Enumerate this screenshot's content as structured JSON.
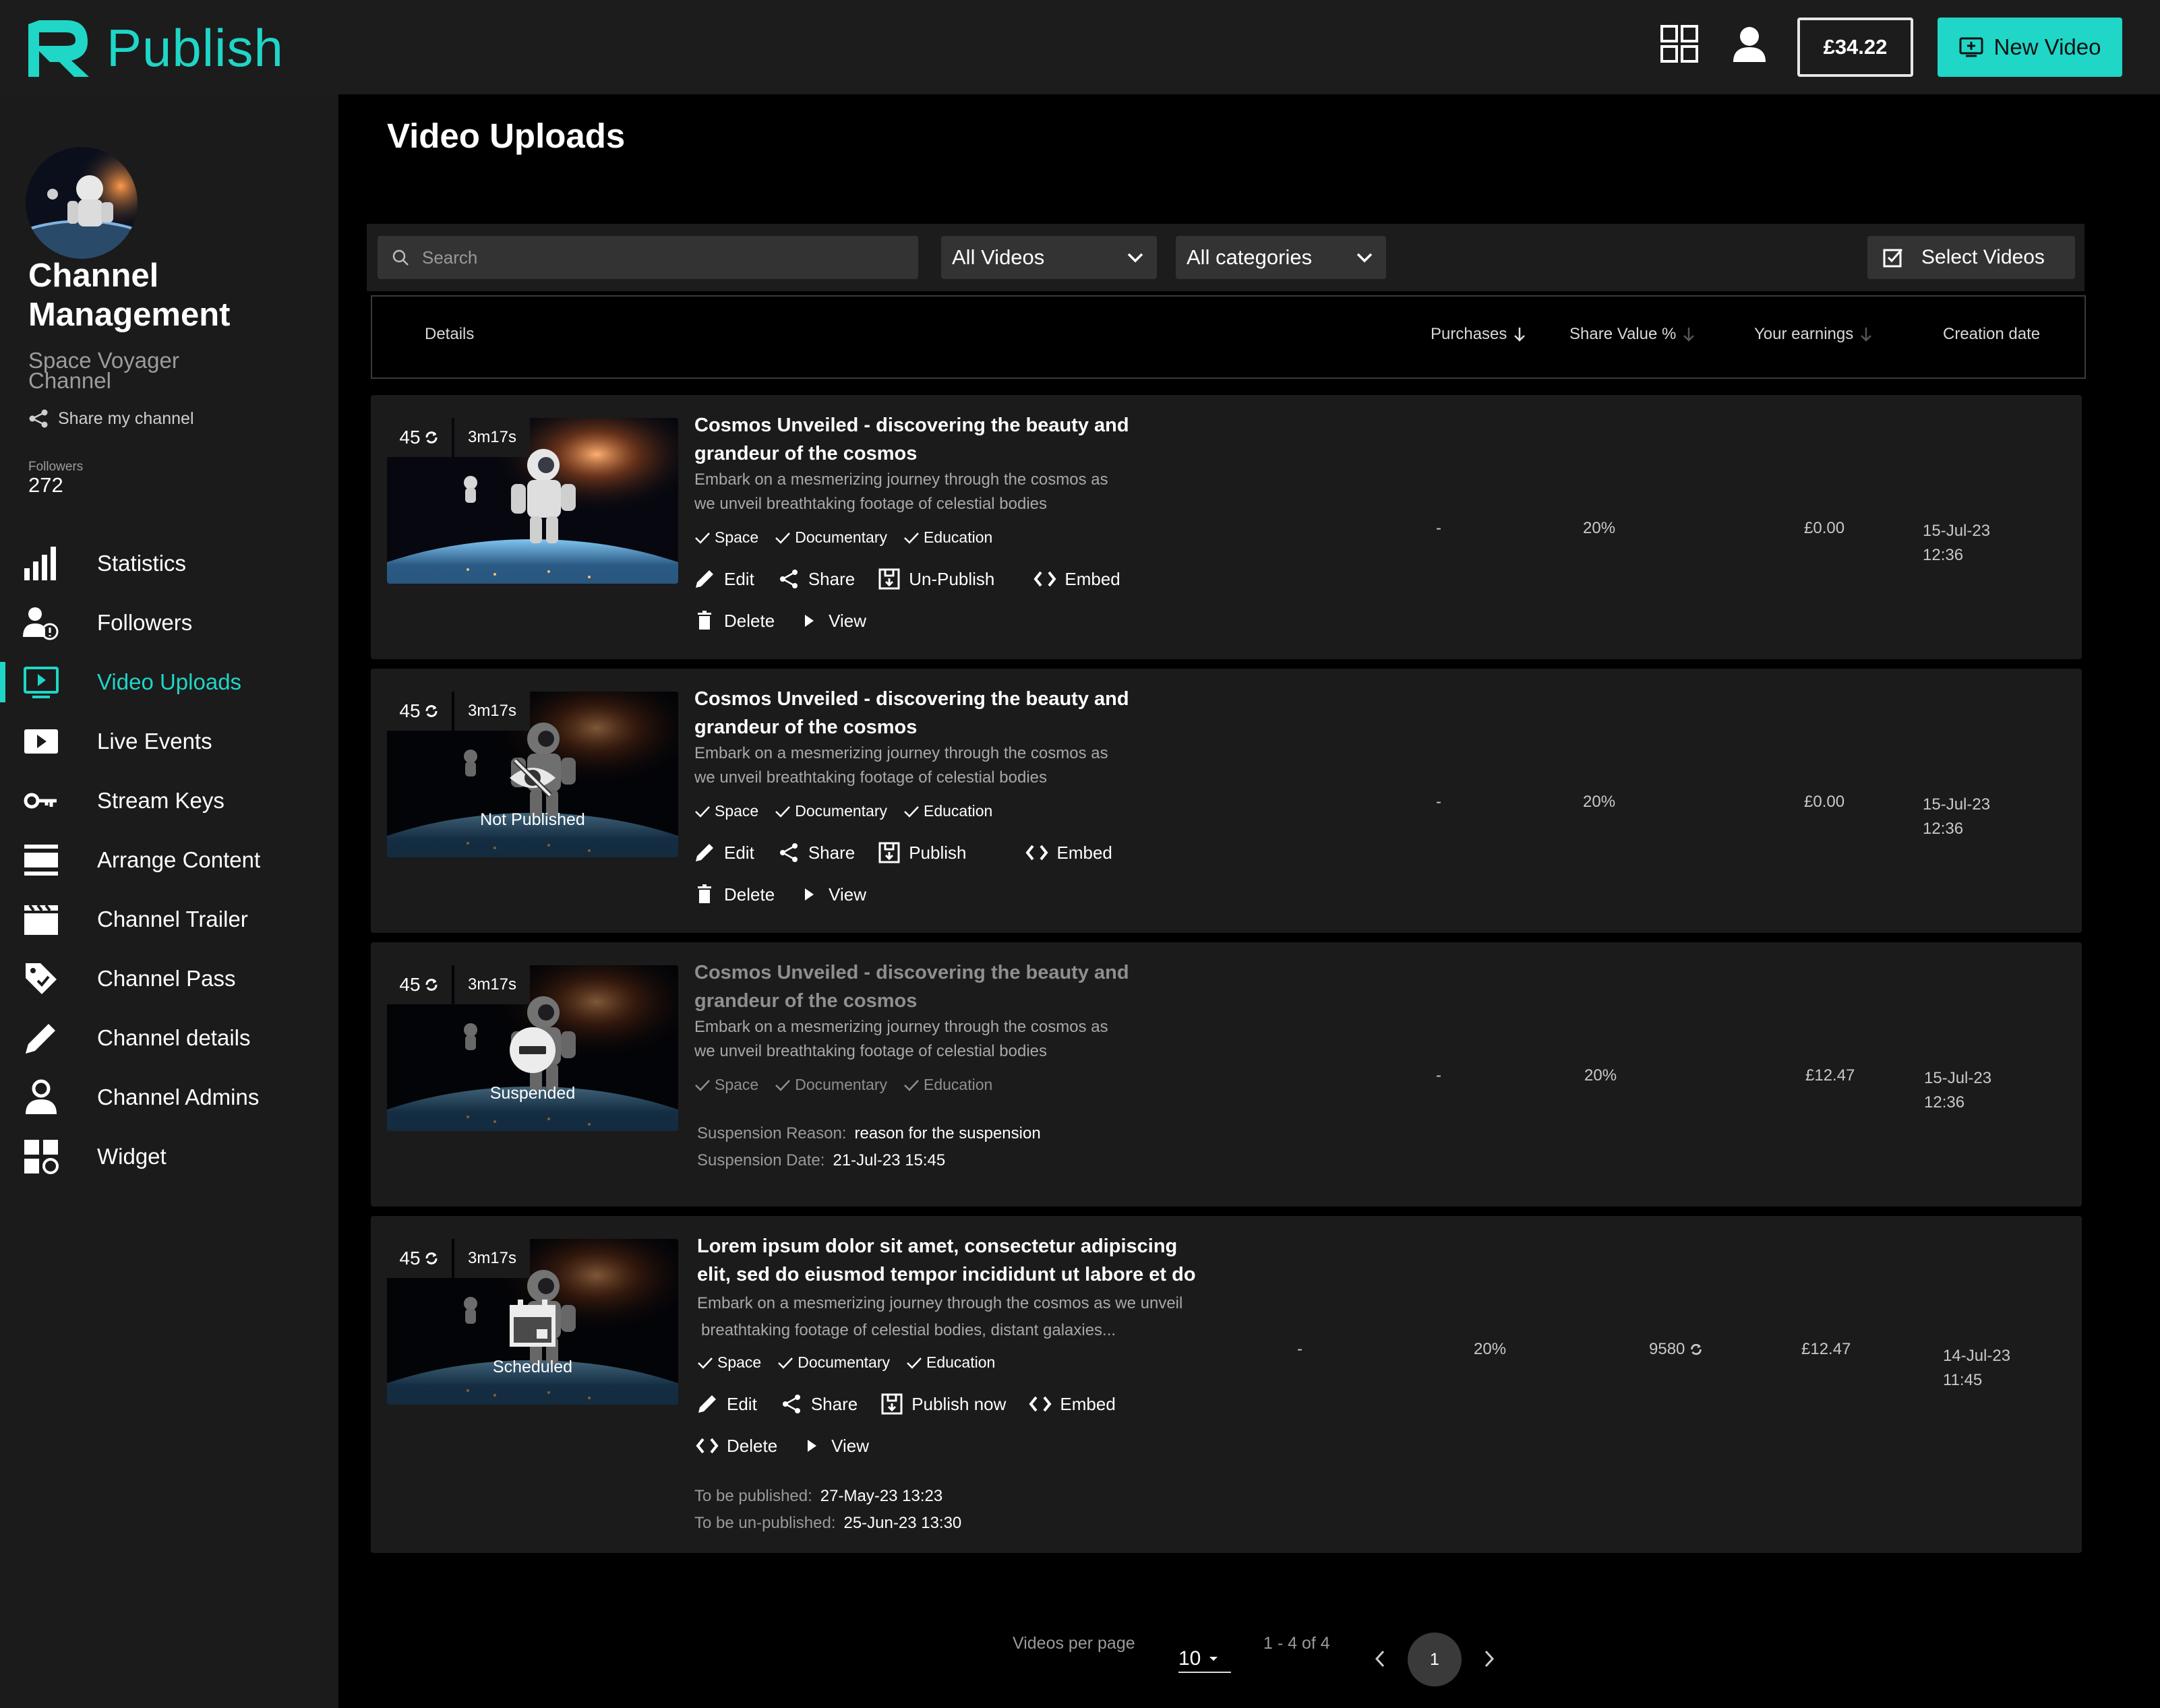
{
  "app": {
    "name": "Publish",
    "balance": "£34.22",
    "new_video_label": "New Video"
  },
  "colors": {
    "accent": "#1fd6c7",
    "background": "#000000",
    "panel": "#1b1b1b"
  },
  "sidebar": {
    "title": "Channel Management",
    "channel_name_line1": "Space Voyager",
    "channel_name_line2": "Channel",
    "share_label": "Share my channel",
    "followers_label": "Followers",
    "followers_count": "272",
    "items": [
      {
        "label": "Statistics",
        "icon": "bar-chart-icon"
      },
      {
        "label": "Followers",
        "icon": "followers-icon"
      },
      {
        "label": "Video Uploads",
        "icon": "video-upload-icon",
        "active": true
      },
      {
        "label": "Live Events",
        "icon": "play-icon"
      },
      {
        "label": "Stream Keys",
        "icon": "key-icon"
      },
      {
        "label": "Arrange Content",
        "icon": "arrange-icon"
      },
      {
        "label": "Channel Trailer",
        "icon": "clapperboard-icon"
      },
      {
        "label": "Channel Pass",
        "icon": "tag-icon"
      },
      {
        "label": "Channel details",
        "icon": "pencil-icon"
      },
      {
        "label": "Channel Admins",
        "icon": "admin-icon"
      },
      {
        "label": "Widget",
        "icon": "widget-icon"
      }
    ]
  },
  "main": {
    "page_title": "Video Uploads",
    "search_placeholder": "Search",
    "filter_videos": "All Videos",
    "filter_categories": "All categories",
    "select_videos_label": "Select Videos",
    "columns": {
      "details": "Details",
      "purchases": "Purchases",
      "share_value": "Share Value %",
      "earnings": "Your earnings",
      "creation_date": "Creation date"
    },
    "rows": [
      {
        "count": "45",
        "duration": "3m17s",
        "status": "",
        "title_line1": "Cosmos Unveiled - discovering the beauty and",
        "title_line2": "grandeur of the cosmos",
        "desc_line1": "Embark on a mesmerizing journey through the cosmos as",
        "desc_line2": "we unveil breathtaking footage of celestial bodies",
        "tags": [
          "Space",
          "Documentary",
          "Education"
        ],
        "actions_row1": [
          "Edit",
          "Share",
          "Un-Publish",
          "Embed"
        ],
        "actions_row2": [
          "Delete",
          "View"
        ],
        "purchases": "-",
        "share_value": "20%",
        "earnings": "£0.00",
        "date": "15-Jul-23",
        "time": "12:36"
      },
      {
        "count": "45",
        "duration": "3m17s",
        "status": "Not Published",
        "title_line1": "Cosmos Unveiled - discovering the beauty and",
        "title_line2": "grandeur of the cosmos",
        "desc_line1": "Embark on a mesmerizing journey through the cosmos as",
        "desc_line2": "we unveil breathtaking footage of celestial bodies",
        "tags": [
          "Space",
          "Documentary",
          "Education"
        ],
        "actions_row1": [
          "Edit",
          "Share",
          "Publish",
          "Embed"
        ],
        "actions_row2": [
          "Delete",
          "View"
        ],
        "purchases": "-",
        "share_value": "20%",
        "earnings": "£0.00",
        "date": "15-Jul-23",
        "time": "12:36"
      },
      {
        "count": "45",
        "duration": "3m17s",
        "status": "Suspended",
        "title_line1": "Cosmos Unveiled - discovering the beauty and",
        "title_line2": "grandeur of the cosmos",
        "desc_line1": "Embark on a mesmerizing journey through the cosmos as",
        "desc_line2": "we unveil breathtaking footage of celestial bodies",
        "tags": [
          "Space",
          "Documentary",
          "Education"
        ],
        "suspension_reason_label": "Suspension Reason:",
        "suspension_reason": "reason for the suspension",
        "suspension_date_label": "Suspension Date:",
        "suspension_date": "21-Jul-23 15:45",
        "purchases": "-",
        "share_value": "20%",
        "earnings": "£12.47",
        "date": "15-Jul-23",
        "time": "12:36"
      },
      {
        "count": "45",
        "duration": "3m17s",
        "status": "Scheduled",
        "title_line1": "Lorem ipsum dolor sit amet, consectetur adipiscing",
        "title_line2": "elit, sed do eiusmod tempor incididunt ut labore et do",
        "desc_line1": "Embark on a mesmerizing journey through the cosmos as we unveil",
        "desc_line2": "breathtaking footage of celestial bodies, distant galaxies...",
        "tags": [
          "Space",
          "Documentary",
          "Education"
        ],
        "actions_row1": [
          "Edit",
          "Share",
          "Publish now",
          "Embed"
        ],
        "actions_row2": [
          "Delete",
          "View"
        ],
        "publish_label": "To be published:",
        "publish_date": "27-May-23 13:23",
        "unpublish_label": "To be un-published:",
        "unpublish_date": "25-Jun-23 13:30",
        "purchases": "-",
        "share_value": "20%",
        "views": "9580",
        "earnings": "£12.47",
        "date": "14-Jul-23",
        "time": "11:45"
      }
    ]
  },
  "pager": {
    "per_page_label": "Videos per page",
    "per_page": "10",
    "range": "1 - 4 of 4",
    "current_page": "1"
  }
}
